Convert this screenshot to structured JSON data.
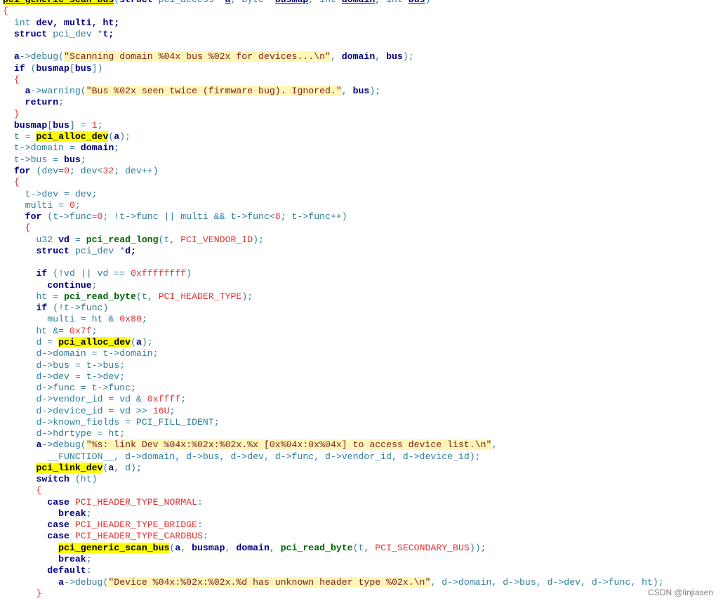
{
  "language": "c",
  "colors": {
    "background": "#ffffff",
    "keyword": "#000080",
    "plain_identifier": "#2e7d9a",
    "function_call": "#006400",
    "number_and_macro": "#e03030",
    "string": "#7a1f1f",
    "string_background": "#fff6b8",
    "function_highlight": "#ffff00"
  },
  "code": {
    "lines": [
      [
        {
          "t": "pci_generic_scan_bus",
          "c": "hl ul"
        },
        {
          "t": "(",
          "c": "cm"
        },
        {
          "t": "struct",
          "c": "kw"
        },
        {
          "t": " pci_access *",
          "c": "cm"
        },
        {
          "t": "a",
          "c": "bold ul"
        },
        {
          "t": ", ",
          "c": "cm"
        },
        {
          "t": "byte",
          "c": "cm"
        },
        {
          "t": " *",
          "c": "cm"
        },
        {
          "t": "busmap",
          "c": "bold ul"
        },
        {
          "t": ", ",
          "c": "cm"
        },
        {
          "t": "int",
          "c": "cm"
        },
        {
          "t": " ",
          "c": "cm"
        },
        {
          "t": "domain",
          "c": "bold ul"
        },
        {
          "t": ", ",
          "c": "cm"
        },
        {
          "t": "int",
          "c": "cm"
        },
        {
          "t": " ",
          "c": "cm"
        },
        {
          "t": "bus",
          "c": "bold ul"
        },
        {
          "t": ")",
          "c": "cm"
        }
      ],
      [
        {
          "t": "{",
          "c": "num"
        }
      ],
      [
        {
          "t": "  int",
          "c": "cm"
        },
        {
          "t": " dev, multi, ht;",
          "c": "bold"
        }
      ],
      [
        {
          "t": "  struct",
          "c": "kw"
        },
        {
          "t": " pci_dev *",
          "c": "cm"
        },
        {
          "t": "t;",
          "c": "bold"
        }
      ],
      [
        {
          "t": "",
          "c": "cm"
        }
      ],
      [
        {
          "t": "  ",
          "c": "cm"
        },
        {
          "t": "a",
          "c": "bold"
        },
        {
          "t": "->debug(",
          "c": "cm"
        },
        {
          "t": "\"Scanning domain %04x bus %02x for devices...\\n\"",
          "c": "str"
        },
        {
          "t": ", ",
          "c": "cm"
        },
        {
          "t": "domain",
          "c": "bold"
        },
        {
          "t": ", ",
          "c": "cm"
        },
        {
          "t": "bus",
          "c": "bold"
        },
        {
          "t": ");",
          "c": "cm"
        }
      ],
      [
        {
          "t": "  if",
          "c": "kw"
        },
        {
          "t": " (",
          "c": "cm"
        },
        {
          "t": "busmap",
          "c": "bold"
        },
        {
          "t": "[",
          "c": "cm"
        },
        {
          "t": "bus",
          "c": "bold"
        },
        {
          "t": "])",
          "c": "cm"
        }
      ],
      [
        {
          "t": "  {",
          "c": "num"
        }
      ],
      [
        {
          "t": "    ",
          "c": "cm"
        },
        {
          "t": "a",
          "c": "bold"
        },
        {
          "t": "->warning(",
          "c": "cm"
        },
        {
          "t": "\"Bus %02x seen twice (firmware bug). Ignored.\"",
          "c": "str"
        },
        {
          "t": ", ",
          "c": "cm"
        },
        {
          "t": "bus",
          "c": "bold"
        },
        {
          "t": ");",
          "c": "cm"
        }
      ],
      [
        {
          "t": "    return",
          "c": "kw"
        },
        {
          "t": ";",
          "c": "cm"
        }
      ],
      [
        {
          "t": "  }",
          "c": "num"
        }
      ],
      [
        {
          "t": "  ",
          "c": "cm"
        },
        {
          "t": "busmap",
          "c": "bold"
        },
        {
          "t": "[",
          "c": "cm"
        },
        {
          "t": "bus",
          "c": "bold"
        },
        {
          "t": "] = ",
          "c": "cm"
        },
        {
          "t": "1",
          "c": "num"
        },
        {
          "t": ";",
          "c": "cm"
        }
      ],
      [
        {
          "t": "  t = ",
          "c": "cm"
        },
        {
          "t": "pci_alloc_dev",
          "c": "hl"
        },
        {
          "t": "(",
          "c": "cm"
        },
        {
          "t": "a",
          "c": "bold"
        },
        {
          "t": ");",
          "c": "cm"
        }
      ],
      [
        {
          "t": "  t->domain = ",
          "c": "cm"
        },
        {
          "t": "domain",
          "c": "bold"
        },
        {
          "t": ";",
          "c": "cm"
        }
      ],
      [
        {
          "t": "  t->bus = ",
          "c": "cm"
        },
        {
          "t": "bus",
          "c": "bold"
        },
        {
          "t": ";",
          "c": "cm"
        }
      ],
      [
        {
          "t": "  for",
          "c": "kw"
        },
        {
          "t": " (dev=",
          "c": "cm"
        },
        {
          "t": "0",
          "c": "num"
        },
        {
          "t": "; dev<",
          "c": "cm"
        },
        {
          "t": "32",
          "c": "num"
        },
        {
          "t": "; dev++)",
          "c": "cm"
        }
      ],
      [
        {
          "t": "  {",
          "c": "num"
        }
      ],
      [
        {
          "t": "    t->dev = dev;",
          "c": "cm"
        }
      ],
      [
        {
          "t": "    multi = ",
          "c": "cm"
        },
        {
          "t": "0",
          "c": "num"
        },
        {
          "t": ";",
          "c": "cm"
        }
      ],
      [
        {
          "t": "    for",
          "c": "kw"
        },
        {
          "t": " (t->func=",
          "c": "cm"
        },
        {
          "t": "0",
          "c": "num"
        },
        {
          "t": "; !t->func || multi && t->func<",
          "c": "cm"
        },
        {
          "t": "8",
          "c": "num"
        },
        {
          "t": "; t->func++)",
          "c": "cm"
        }
      ],
      [
        {
          "t": "    {",
          "c": "num"
        }
      ],
      [
        {
          "t": "      u32 ",
          "c": "cm"
        },
        {
          "t": "vd",
          "c": "bold"
        },
        {
          "t": " = ",
          "c": "cm"
        },
        {
          "t": "pci_read_long",
          "c": "func"
        },
        {
          "t": "(t, ",
          "c": "cm"
        },
        {
          "t": "PCI_VENDOR_ID",
          "c": "mac"
        },
        {
          "t": ");",
          "c": "cm"
        }
      ],
      [
        {
          "t": "      struct",
          "c": "kw"
        },
        {
          "t": " pci_dev *",
          "c": "cm"
        },
        {
          "t": "d;",
          "c": "bold"
        }
      ],
      [
        {
          "t": "",
          "c": "cm"
        }
      ],
      [
        {
          "t": "      if",
          "c": "kw"
        },
        {
          "t": " (!vd || vd == ",
          "c": "cm"
        },
        {
          "t": "0xffffffff",
          "c": "num"
        },
        {
          "t": ")",
          "c": "cm"
        }
      ],
      [
        {
          "t": "        continue",
          "c": "kw"
        },
        {
          "t": ";",
          "c": "cm"
        }
      ],
      [
        {
          "t": "      ht = ",
          "c": "cm"
        },
        {
          "t": "pci_read_byte",
          "c": "func"
        },
        {
          "t": "(t, ",
          "c": "cm"
        },
        {
          "t": "PCI_HEADER_TYPE",
          "c": "mac"
        },
        {
          "t": ");",
          "c": "cm"
        }
      ],
      [
        {
          "t": "      if",
          "c": "kw"
        },
        {
          "t": " (!t->func)",
          "c": "cm"
        }
      ],
      [
        {
          "t": "        multi = ht & ",
          "c": "cm"
        },
        {
          "t": "0x80",
          "c": "num"
        },
        {
          "t": ";",
          "c": "cm"
        }
      ],
      [
        {
          "t": "      ht &= ",
          "c": "cm"
        },
        {
          "t": "0x7f",
          "c": "num"
        },
        {
          "t": ";",
          "c": "cm"
        }
      ],
      [
        {
          "t": "      d = ",
          "c": "cm"
        },
        {
          "t": "pci_alloc_dev",
          "c": "hl"
        },
        {
          "t": "(",
          "c": "cm"
        },
        {
          "t": "a",
          "c": "bold"
        },
        {
          "t": ");",
          "c": "cm"
        }
      ],
      [
        {
          "t": "      d->domain = t->domain;",
          "c": "cm"
        }
      ],
      [
        {
          "t": "      d->bus = t->bus;",
          "c": "cm"
        }
      ],
      [
        {
          "t": "      d->dev = t->dev;",
          "c": "cm"
        }
      ],
      [
        {
          "t": "      d->func = t->func;",
          "c": "cm"
        }
      ],
      [
        {
          "t": "      d->vendor_id = vd & ",
          "c": "cm"
        },
        {
          "t": "0xffff",
          "c": "num"
        },
        {
          "t": ";",
          "c": "cm"
        }
      ],
      [
        {
          "t": "      d->device_id = vd >> ",
          "c": "cm"
        },
        {
          "t": "16U",
          "c": "num"
        },
        {
          "t": ";",
          "c": "cm"
        }
      ],
      [
        {
          "t": "      d->known_fields = PCI_FILL_IDENT;",
          "c": "cm"
        }
      ],
      [
        {
          "t": "      d->hdrtype = ht;",
          "c": "cm"
        }
      ],
      [
        {
          "t": "      ",
          "c": "cm"
        },
        {
          "t": "a",
          "c": "bold"
        },
        {
          "t": "->debug(",
          "c": "cm"
        },
        {
          "t": "\"%s: link Dev %04x:%02x:%02x.%x [0x%04x:0x%04x] to access device list.\\n\"",
          "c": "str"
        },
        {
          "t": ",",
          "c": "cm"
        }
      ],
      [
        {
          "t": "        __FUNCTION__, d->domain, d->bus, d->dev, d->func, d->vendor_id, d->device_id);",
          "c": "cm"
        }
      ],
      [
        {
          "t": "      ",
          "c": "cm"
        },
        {
          "t": "pci_link_dev",
          "c": "hl"
        },
        {
          "t": "(",
          "c": "cm"
        },
        {
          "t": "a",
          "c": "bold"
        },
        {
          "t": ", d);",
          "c": "cm"
        }
      ],
      [
        {
          "t": "      switch",
          "c": "kw"
        },
        {
          "t": " (ht)",
          "c": "cm"
        }
      ],
      [
        {
          "t": "      {",
          "c": "num"
        }
      ],
      [
        {
          "t": "        case",
          "c": "kw"
        },
        {
          "t": " ",
          "c": "cm"
        },
        {
          "t": "PCI_HEADER_TYPE_NORMAL",
          "c": "mac"
        },
        {
          "t": ":",
          "c": "cm"
        }
      ],
      [
        {
          "t": "          break",
          "c": "kw"
        },
        {
          "t": ";",
          "c": "cm"
        }
      ],
      [
        {
          "t": "        case",
          "c": "kw"
        },
        {
          "t": " ",
          "c": "cm"
        },
        {
          "t": "PCI_HEADER_TYPE_BRIDGE",
          "c": "mac"
        },
        {
          "t": ":",
          "c": "cm"
        }
      ],
      [
        {
          "t": "        case",
          "c": "kw"
        },
        {
          "t": " ",
          "c": "cm"
        },
        {
          "t": "PCI_HEADER_TYPE_CARDBUS",
          "c": "mac"
        },
        {
          "t": ":",
          "c": "cm"
        }
      ],
      [
        {
          "t": "          ",
          "c": "cm"
        },
        {
          "t": "pci_generic_scan_bus",
          "c": "hl"
        },
        {
          "t": "(",
          "c": "cm"
        },
        {
          "t": "a",
          "c": "bold"
        },
        {
          "t": ", ",
          "c": "cm"
        },
        {
          "t": "busmap",
          "c": "bold"
        },
        {
          "t": ", ",
          "c": "cm"
        },
        {
          "t": "domain",
          "c": "bold"
        },
        {
          "t": ", ",
          "c": "cm"
        },
        {
          "t": "pci_read_byte",
          "c": "func"
        },
        {
          "t": "(t, ",
          "c": "cm"
        },
        {
          "t": "PCI_SECONDARY_BUS",
          "c": "mac"
        },
        {
          "t": "));",
          "c": "cm"
        }
      ],
      [
        {
          "t": "          break",
          "c": "kw"
        },
        {
          "t": ";",
          "c": "cm"
        }
      ],
      [
        {
          "t": "        default",
          "c": "kw"
        },
        {
          "t": ":",
          "c": "cm"
        }
      ],
      [
        {
          "t": "          ",
          "c": "cm"
        },
        {
          "t": "a",
          "c": "bold"
        },
        {
          "t": "->debug(",
          "c": "cm"
        },
        {
          "t": "\"Device %04x:%02x:%02x.%d has unknown header type %02x.\\n\"",
          "c": "str"
        },
        {
          "t": ", d->domain, d->bus, d->dev, d->func, ht);",
          "c": "cm"
        }
      ],
      [
        {
          "t": "      }",
          "c": "num"
        }
      ]
    ]
  },
  "watermark": "CSDN @linjiasen"
}
